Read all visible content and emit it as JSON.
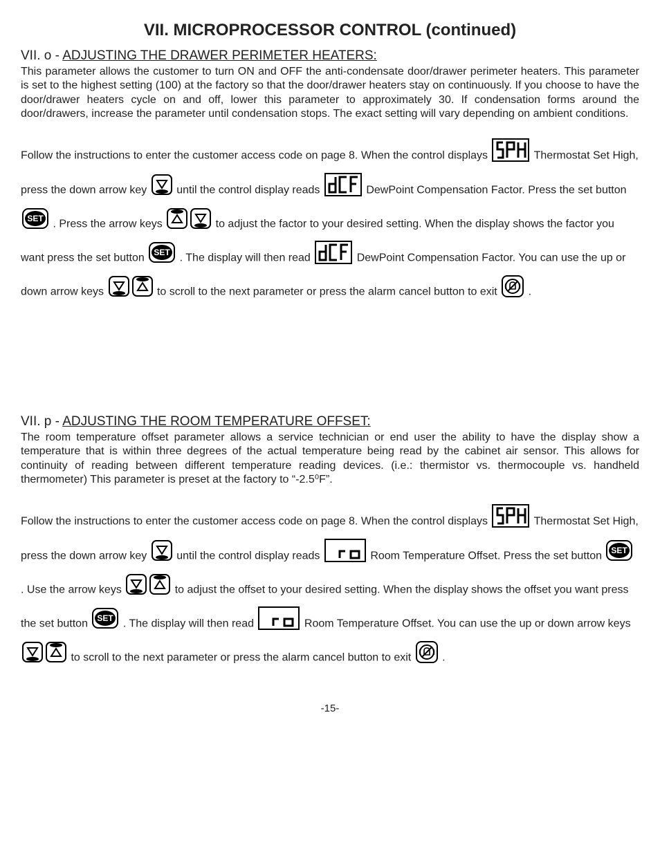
{
  "pageTitle": "VII. MICROPROCESSOR CONTROL (continued)",
  "sectionO": {
    "prefix": "VII. o - ",
    "heading": "ADJUSTING THE DRAWER PERIMETER HEATERS:",
    "para": "This parameter allows the customer to turn ON and OFF the anti-condensate door/drawer perimeter heaters. This parameter is set to the highest setting (100) at the factory so that the door/drawer heaters stay on continuously. If you choose to have the door/drawer heaters cycle on and off, lower this parameter to approximately 30.  If condensation forms around the door/drawers, increase the parameter until condensation stops. The exact setting will vary depending on ambient conditions.",
    "t1": "Follow the instructions to enter the customer access code on page 8.  When the control displays ",
    "t2": " Thermostat Set High, press the down arrow key ",
    "t3": " until the control display reads ",
    "t4": " DewPoint Compensation Factor.  Press the set button ",
    "t5": " .  Press the arrow keys ",
    "t6": " to adjust the factor to your desired setting.   When the display shows the factor you want press the set button ",
    "t7": " .   The display will then read ",
    "t8": " DewPoint Compensation Factor.   You can use the up or down arrow keys ",
    "t9": " to scroll to the next parameter or press the alarm cancel button to exit ",
    "t10": " ."
  },
  "sectionP": {
    "prefix": "VII. p - ",
    "heading": "ADJUSTING THE ROOM TEMPERATURE OFFSET:",
    "para": "The room temperature offset parameter allows a service technician or end user the ability to have the display show a temperature that is within three degrees of the actual temperature being read by the cabinet air sensor.  This allows for continuity of reading between different temperature reading devices. (i.e.: thermistor vs. thermocouple vs. handheld thermometer) This parameter is preset at the factory to “-2.5⁰F”.",
    "t1": "Follow the instructions to enter the customer access code on page 8.  When the control displays ",
    "t2": " Thermostat Set High, press the down arrow key ",
    "t3": " until  the control display reads ",
    "t4": " Room Temperature Offset. Press the set button ",
    "t5": " .   Use the arrow keys ",
    "t6": " to adjust the offset to your desired setting.  When the display shows the offset you want press the set button ",
    "t7": " .   The display will then read ",
    "t8": " Room Temperature Offset.  You can use the up or down arrow keys ",
    "t9": " to scroll to the next parameter or press the alarm cancel button to exit ",
    "t10": " ."
  },
  "pageNumber": "-15-"
}
